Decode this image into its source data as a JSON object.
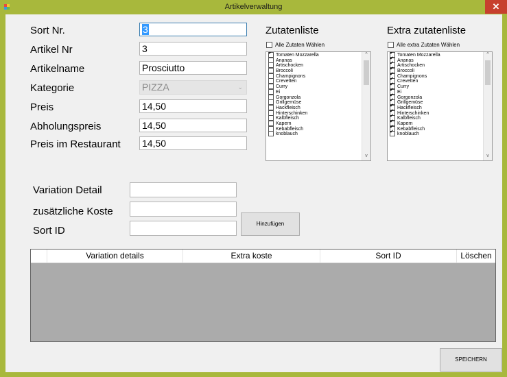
{
  "window": {
    "title": "Artikelverwaltung",
    "close_label": "✕"
  },
  "form": {
    "sort_nr": {
      "label": "Sort Nr.",
      "value": "3"
    },
    "artikel_nr": {
      "label": "Artikel Nr",
      "value": "3"
    },
    "artikelname": {
      "label": "Artikelname",
      "value": "Prosciutto"
    },
    "kategorie": {
      "label": "Kategorie",
      "value": "PIZZA"
    },
    "preis": {
      "label": "Preis",
      "value": "14,50"
    },
    "abholungspreis": {
      "label": "Abholungspreis",
      "value": "14,50"
    },
    "preis_restaurant": {
      "label": "Preis im Restaurant",
      "value": "14,50"
    }
  },
  "zutaten": {
    "title": "Zutatenliste",
    "select_all_label": "Alle Zutaten Wählen",
    "select_all_checked": false,
    "items": [
      {
        "label": "Tomaten Mozzarella",
        "checked": true
      },
      {
        "label": "Ananas",
        "checked": false
      },
      {
        "label": "Artischocken",
        "checked": false
      },
      {
        "label": "Broccoli",
        "checked": false
      },
      {
        "label": "Champignons",
        "checked": false
      },
      {
        "label": "Crevetten",
        "checked": false
      },
      {
        "label": "Curry",
        "checked": false
      },
      {
        "label": "Ei",
        "checked": false
      },
      {
        "label": "Gorgonzola",
        "checked": false
      },
      {
        "label": "Grillgemüse",
        "checked": false
      },
      {
        "label": "Hackfleisch",
        "checked": false
      },
      {
        "label": "Hinterschinken",
        "checked": false
      },
      {
        "label": "Kalbfleisch",
        "checked": false
      },
      {
        "label": "Kapern",
        "checked": false
      },
      {
        "label": "Kebabfleisch",
        "checked": false
      },
      {
        "label": "knoblauch",
        "checked": false
      }
    ]
  },
  "extra_zutaten": {
    "title": "Extra zutatenliste",
    "select_all_label": "Alle extra Zutaten Wählen",
    "select_all_checked": false,
    "items": [
      {
        "label": "Tomaten Mozzarella",
        "checked": true
      },
      {
        "label": "Ananas",
        "checked": true
      },
      {
        "label": "Artischocken",
        "checked": true
      },
      {
        "label": "Broccoli",
        "checked": true
      },
      {
        "label": "Champignons",
        "checked": true
      },
      {
        "label": "Crevetten",
        "checked": true
      },
      {
        "label": "Curry",
        "checked": true
      },
      {
        "label": "Ei",
        "checked": true
      },
      {
        "label": "Gorgonzola",
        "checked": true
      },
      {
        "label": "Grillgemüse",
        "checked": true
      },
      {
        "label": "Hackfleisch",
        "checked": true
      },
      {
        "label": "Hinterschinken",
        "checked": true
      },
      {
        "label": "Kalbfleisch",
        "checked": true
      },
      {
        "label": "Kapern",
        "checked": true
      },
      {
        "label": "Kebabfleisch",
        "checked": true
      },
      {
        "label": "knoblauch",
        "checked": true
      }
    ]
  },
  "variation": {
    "detail_label": "Variation Detail",
    "detail_value": "",
    "koste_label": "zusätzliche Koste",
    "koste_value": "",
    "sort_id_label": "Sort ID",
    "sort_id_value": "",
    "add_button": "Hinzufügen"
  },
  "table": {
    "columns": [
      "Variation details",
      "Extra koste",
      "Sort ID",
      "Löschen"
    ],
    "rows": []
  },
  "save_button": "SPEICHERN",
  "icons": {
    "app": "app-icon",
    "close": "close-icon",
    "combo_arrow": "chevron-down-icon",
    "scroll_up": "chevron-up-icon",
    "scroll_down": "chevron-down-icon"
  },
  "colors": {
    "window_frame": "#a8b83c",
    "close_button": "#c7402e",
    "selection": "#3399ff",
    "grid_background": "#ababab"
  }
}
